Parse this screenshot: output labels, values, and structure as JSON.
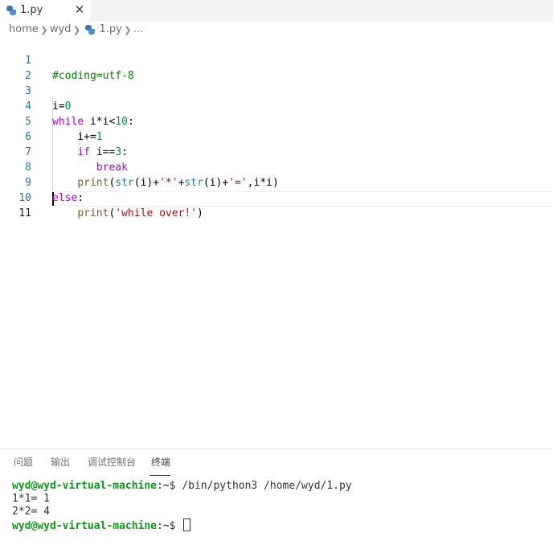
{
  "editor_tab": {
    "label": "1.py",
    "icon": "python-file-icon",
    "close_glyph": "✕"
  },
  "breadcrumb": {
    "items": [
      "home",
      "wyd",
      "1.py",
      "..."
    ]
  },
  "code_lines": [
    {
      "num": "1"
    },
    {
      "num": "2"
    },
    {
      "num": "3"
    },
    {
      "num": "4"
    },
    {
      "num": "5"
    },
    {
      "num": "6"
    },
    {
      "num": "7"
    },
    {
      "num": "8"
    },
    {
      "num": "9"
    },
    {
      "num": "10"
    },
    {
      "num": "11"
    }
  ],
  "code": {
    "l1": {
      "comment": "#coding=utf-8"
    },
    "l3": {
      "var": "i",
      "op": "=",
      "num": "0"
    },
    "l4": {
      "kw": "while",
      "expr": " i*i<",
      "num": "10",
      "end": ":"
    },
    "l5": {
      "indent": "    ",
      "expr": "i+=",
      "num": "1"
    },
    "l6": {
      "indent": "    ",
      "kw": "if",
      "expr": " i==",
      "num": "3",
      "end": ":"
    },
    "l7": {
      "indent": "       ",
      "kw": "break"
    },
    "l8": {
      "indent": "    ",
      "fn": "print",
      "p1": "(",
      "bi1": "str",
      "a1": "(i)+",
      "s1": "'*'",
      "plus": "+",
      "bi2": "str",
      "a2": "(i)+",
      "s2": "'='",
      "tail": ",i*i)"
    },
    "l9": {
      "kw": "else",
      "end": ":"
    },
    "l10": {
      "indent": "    ",
      "fn": "print",
      "p1": "(",
      "s1": "'while over!'",
      "p2": ")"
    }
  },
  "panel": {
    "tabs": [
      "问题",
      "输出",
      "调试控制台",
      "终端"
    ],
    "active_tab": "终端"
  },
  "terminal": {
    "user_host": "wyd@wyd-virtual-machine",
    "colon": ":",
    "path": "~",
    "prompt": "$ ",
    "command": "/bin/python3 /home/wyd/1.py",
    "output": [
      "1*1= 1",
      "2*2= 4"
    ]
  },
  "colors": {
    "keyword": "#af00db",
    "number": "#098658",
    "string": "#a31515",
    "function": "#795e26",
    "builtin": "#267f99",
    "line_number": "#237893",
    "terminal_user": "#0a9e13",
    "terminal_path": "#0451a5"
  }
}
